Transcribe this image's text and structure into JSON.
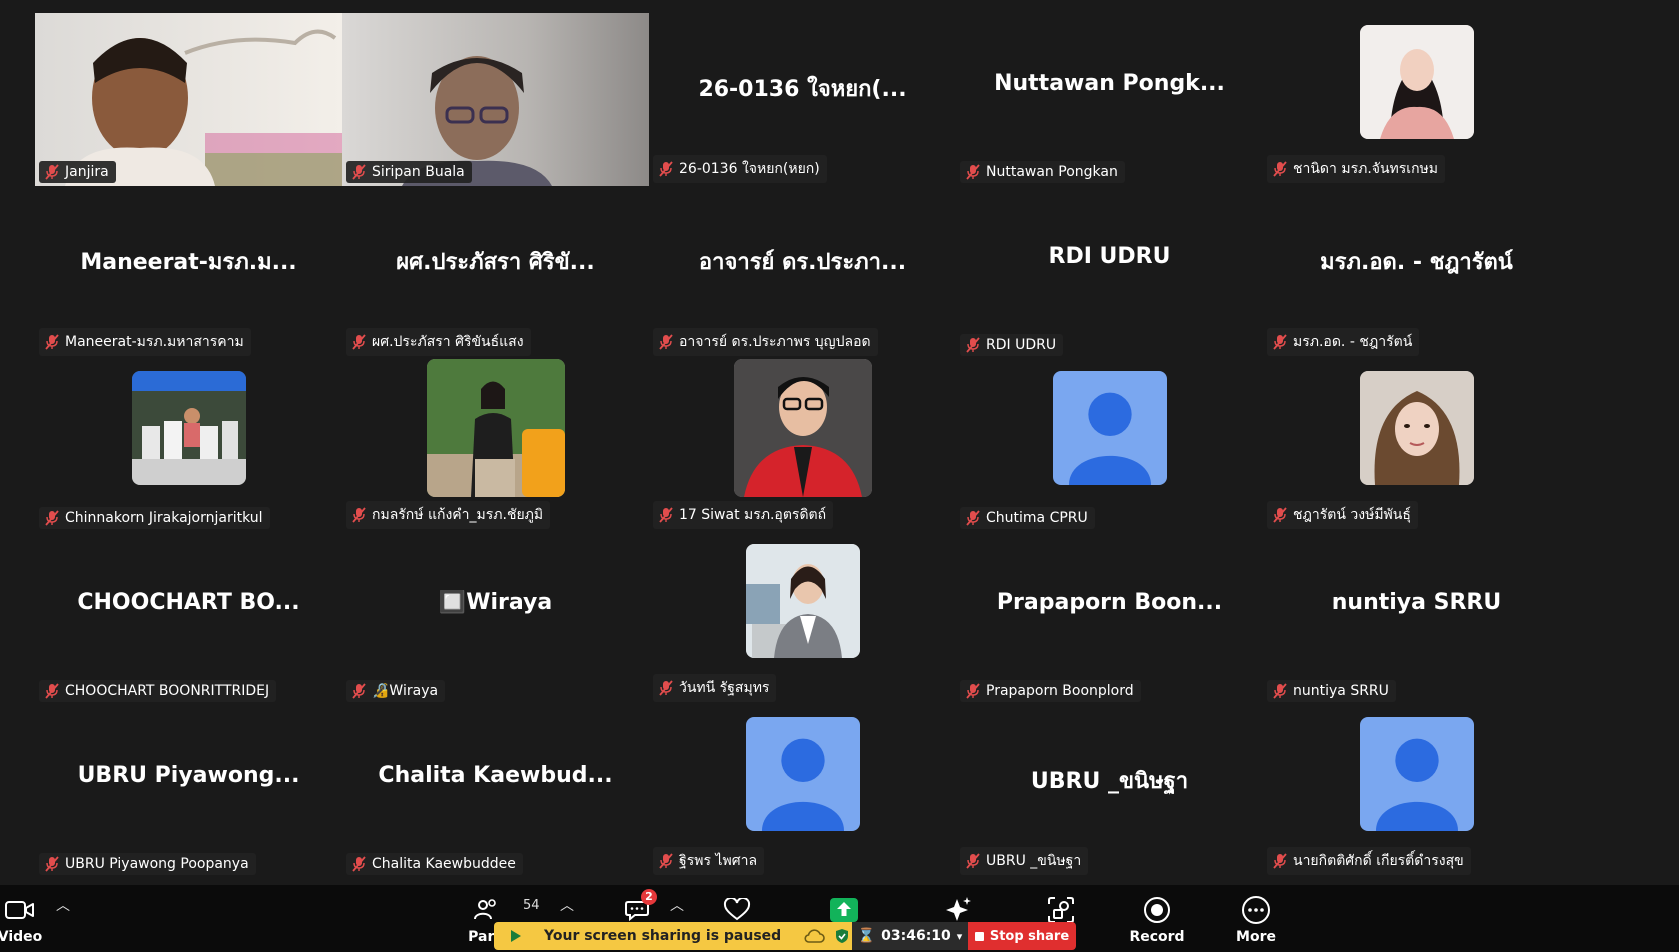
{
  "tiles": [
    {
      "id": "t1",
      "label": "Janjira",
      "big": "",
      "kind": "video1"
    },
    {
      "id": "t2",
      "label": "Siripan Buala",
      "big": "",
      "kind": "video2"
    },
    {
      "id": "t3",
      "label": "26-0136 ใจหยก(หยก)",
      "big": "26-0136 ใจหยก(...",
      "kind": "text"
    },
    {
      "id": "t4",
      "label": "Nuttawan Pongkan",
      "big": "Nuttawan  Pongk...",
      "kind": "text"
    },
    {
      "id": "t5",
      "label": "ชานิดา มรภ.จันทรเกษม",
      "big": "",
      "kind": "photo-pink"
    },
    {
      "id": "t6",
      "label": "Maneerat-มรภ.มหาสารคาม",
      "big": "Maneerat-มรภ.ม...",
      "kind": "text"
    },
    {
      "id": "t7",
      "label": "ผศ.ประภัสรา ศิริขันธ์แสง",
      "big": "ผศ.ประภัสรา ศิริขั...",
      "kind": "text"
    },
    {
      "id": "t8",
      "label": "อาจารย์ ดร.ประภาพร บุญปลอด",
      "big": "อาจารย์ ดร.ประภา...",
      "kind": "text"
    },
    {
      "id": "t9",
      "label": "RDI UDRU",
      "big": "RDI UDRU",
      "kind": "text"
    },
    {
      "id": "t10",
      "label": "มรภ.อด. - ชฎารัตน์",
      "big": "มรภ.อด. - ชฎารัตน์",
      "kind": "text"
    },
    {
      "id": "t11",
      "label": "Chinnakorn Jirakajornjaritkul",
      "big": "",
      "kind": "photo-shop"
    },
    {
      "id": "t12",
      "label": "กมลรักษ์ แก้งคำ_มรภ.ชัยภูมิ",
      "big": "",
      "kind": "photo-garden"
    },
    {
      "id": "t13",
      "label": "17 Siwat มรภ.อุตรดิตถ์",
      "big": "",
      "kind": "photo-red"
    },
    {
      "id": "t14",
      "label": "Chutima CPRU",
      "big": "",
      "kind": "default"
    },
    {
      "id": "t15",
      "label": "ชฎารัตน์ วงษ์มีพันธุ์",
      "big": "",
      "kind": "photo-girl"
    },
    {
      "id": "t16",
      "label": "CHOOCHART BOONRITTRIDEJ",
      "big": "CHOOCHART  BO...",
      "kind": "text"
    },
    {
      "id": "t17",
      "label": "🔏Wiraya",
      "big": "🔲Wiraya",
      "kind": "text"
    },
    {
      "id": "t18",
      "label": "วันทนี รัฐสมุทร",
      "big": "",
      "kind": "photo-office"
    },
    {
      "id": "t19",
      "label": "Prapaporn Boonplord",
      "big": "Prapaporn  Boon...",
      "kind": "text"
    },
    {
      "id": "t20",
      "label": "nuntiya SRRU",
      "big": "nuntiya SRRU",
      "kind": "text"
    },
    {
      "id": "t21",
      "label": "UBRU Piyawong Poopanya",
      "big": "UBRU  Piyawong...",
      "kind": "text"
    },
    {
      "id": "t22",
      "label": "Chalita Kaewbuddee",
      "big": "Chalita  Kaewbud...",
      "kind": "text"
    },
    {
      "id": "t23",
      "label": "ฐิรพร ไพศาล",
      "big": "",
      "kind": "default"
    },
    {
      "id": "t24",
      "label": "UBRU _ขนิษฐา",
      "big": "UBRU _ขนิษฐา",
      "kind": "text"
    },
    {
      "id": "t25",
      "label": "นายกิตติศักดิ์ เกียรติ์ดำรงสุข",
      "big": "",
      "kind": "default"
    }
  ],
  "toolbar": {
    "video_label": "Video",
    "participants_label": "Parti",
    "participants_count": "54",
    "chat_badge": "2",
    "record_label": "Record",
    "more_label": "More",
    "banner_text": "Your screen sharing is paused",
    "timer": "03:46:10",
    "stop_share_label": "Stop share"
  },
  "colors": {
    "background": "#1a1a1a",
    "toolbar": "#0b0b0b",
    "banner_yellow": "#f5c842",
    "stop_red": "#e02f2f",
    "default_avatar": "#7aa7f0",
    "mute_red": "#e24d4d"
  },
  "icons": [
    "muted-mic-icon",
    "camera-icon",
    "participants-icon",
    "chat-icon",
    "react-heart-icon",
    "share-arrow-icon",
    "ai-companion-icon",
    "apps-icon",
    "record-icon",
    "more-icon"
  ]
}
